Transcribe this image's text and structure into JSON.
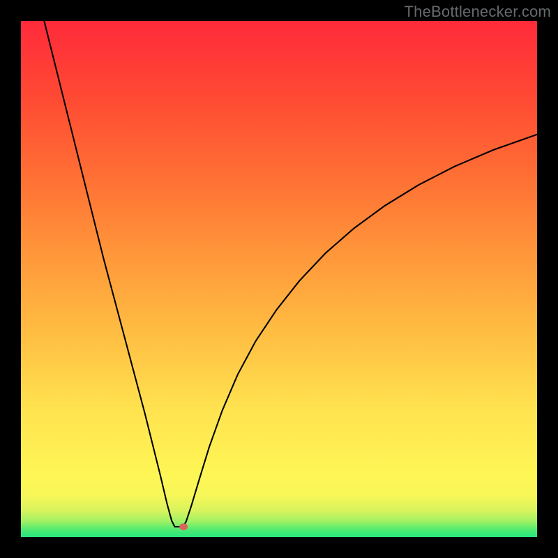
{
  "watermark": "TheBottlenecker.com",
  "chart_data": {
    "type": "line",
    "title": "",
    "xlabel": "",
    "ylabel": "",
    "xlim": [
      0,
      100
    ],
    "ylim": [
      0,
      100
    ],
    "grid": false,
    "legend": false,
    "notch": {
      "x": 30.5,
      "bottom": 2
    },
    "background_gradient": {
      "stops": [
        {
          "y": 0.0,
          "color": "#28e67e"
        },
        {
          "y": 0.01,
          "color": "#40e876"
        },
        {
          "y": 0.02,
          "color": "#6aee6c"
        },
        {
          "y": 0.03,
          "color": "#9ef164"
        },
        {
          "y": 0.05,
          "color": "#d6f35d"
        },
        {
          "y": 0.08,
          "color": "#f7f658"
        },
        {
          "y": 0.12,
          "color": "#fef655"
        },
        {
          "y": 0.25,
          "color": "#ffe24f"
        },
        {
          "y": 0.4,
          "color": "#ffbc42"
        },
        {
          "y": 0.55,
          "color": "#ff963a"
        },
        {
          "y": 0.7,
          "color": "#ff6f34"
        },
        {
          "y": 0.85,
          "color": "#ff4a33"
        },
        {
          "y": 1.0,
          "color": "#ff2a3a"
        }
      ]
    },
    "marker": {
      "x": 31.5,
      "y": 2,
      "color": "#d9645a",
      "rx": 6,
      "ry": 5
    },
    "series": [
      {
        "name": "curve",
        "color": "#000000",
        "width": 2.1,
        "points": [
          {
            "x": 4.5,
            "y": 100
          },
          {
            "x": 6,
            "y": 94
          },
          {
            "x": 8,
            "y": 86
          },
          {
            "x": 10,
            "y": 78
          },
          {
            "x": 12,
            "y": 70
          },
          {
            "x": 14,
            "y": 62
          },
          {
            "x": 16,
            "y": 54
          },
          {
            "x": 18,
            "y": 46.5
          },
          {
            "x": 20,
            "y": 39
          },
          {
            "x": 22,
            "y": 31.5
          },
          {
            "x": 24,
            "y": 24
          },
          {
            "x": 25.5,
            "y": 18
          },
          {
            "x": 27,
            "y": 12
          },
          {
            "x": 28.3,
            "y": 6.5
          },
          {
            "x": 29.2,
            "y": 3.2
          },
          {
            "x": 29.8,
            "y": 2.0
          },
          {
            "x": 31.4,
            "y": 2.0
          },
          {
            "x": 32.0,
            "y": 3.0
          },
          {
            "x": 33.0,
            "y": 6.0
          },
          {
            "x": 34.5,
            "y": 11.0
          },
          {
            "x": 36.5,
            "y": 17.5
          },
          {
            "x": 39,
            "y": 24.5
          },
          {
            "x": 42,
            "y": 31.5
          },
          {
            "x": 45.5,
            "y": 38
          },
          {
            "x": 49.5,
            "y": 44
          },
          {
            "x": 54,
            "y": 49.7
          },
          {
            "x": 59,
            "y": 55
          },
          {
            "x": 64.5,
            "y": 59.8
          },
          {
            "x": 70.5,
            "y": 64.2
          },
          {
            "x": 77,
            "y": 68.2
          },
          {
            "x": 84,
            "y": 71.8
          },
          {
            "x": 91.5,
            "y": 75
          },
          {
            "x": 100,
            "y": 78
          }
        ]
      }
    ]
  }
}
